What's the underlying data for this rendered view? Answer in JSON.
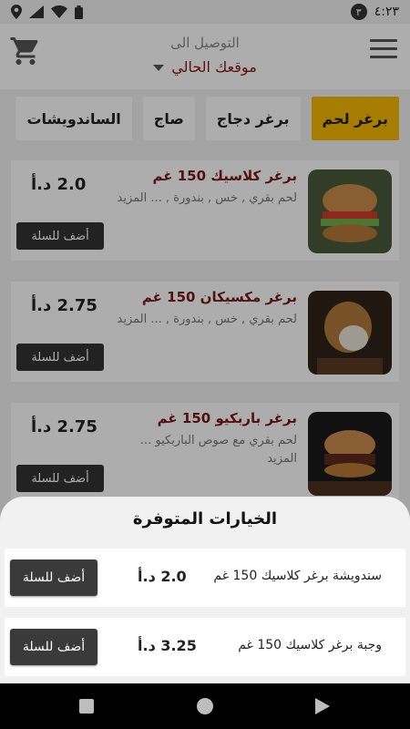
{
  "status_bar": {
    "time": "٤:٢٣",
    "notification_badge": "٣",
    "icons": [
      "location-icon",
      "cellular-icon",
      "wifi-icon",
      "battery-icon"
    ]
  },
  "header": {
    "delivery_label": "التوصيل الى",
    "location_value": "موقعك الحالي",
    "icons": [
      "cart-icon",
      "menu-icon",
      "dropdown-caret-icon"
    ]
  },
  "tabs": [
    {
      "label": "برغر لحم",
      "active": true
    },
    {
      "label": "برغر دجاج",
      "active": false
    },
    {
      "label": "صاج",
      "active": false
    },
    {
      "label": "الساندويشات",
      "active": false
    }
  ],
  "products": [
    {
      "title": "برغر كلاسيك 150 غم",
      "description": "لحم بقري , خس , بندورة , ... المزيد",
      "price": "2.0 د.أ",
      "button": "أضف للسلة"
    },
    {
      "title": "برغر مكسيكان 150 غم",
      "description": "لحم بقري , خس , بندورة , ... المزيد",
      "price": "2.75 د.أ",
      "button": "أضف للسلة"
    },
    {
      "title": "برغر باربكيو 150 غم",
      "description": "لحم بقري مع صوص الباربكيو ... المزيد",
      "price": "2.75 د.أ",
      "button": "أضف للسلة"
    }
  ],
  "sheet": {
    "title": "الخيارات المتوفرة",
    "options": [
      {
        "name": "سندويشة برغر كلاسيك 150 غم",
        "price": "2.0 د.أ",
        "button": "أضف للسلة"
      },
      {
        "name": "وجبة برغر كلاسيك 150 غم",
        "price": "3.25 د.أ",
        "button": "أضف للسلة"
      }
    ]
  },
  "colors": {
    "accent": "#f5b800",
    "title_red": "#7a1a1a",
    "button_dark": "#333333"
  }
}
